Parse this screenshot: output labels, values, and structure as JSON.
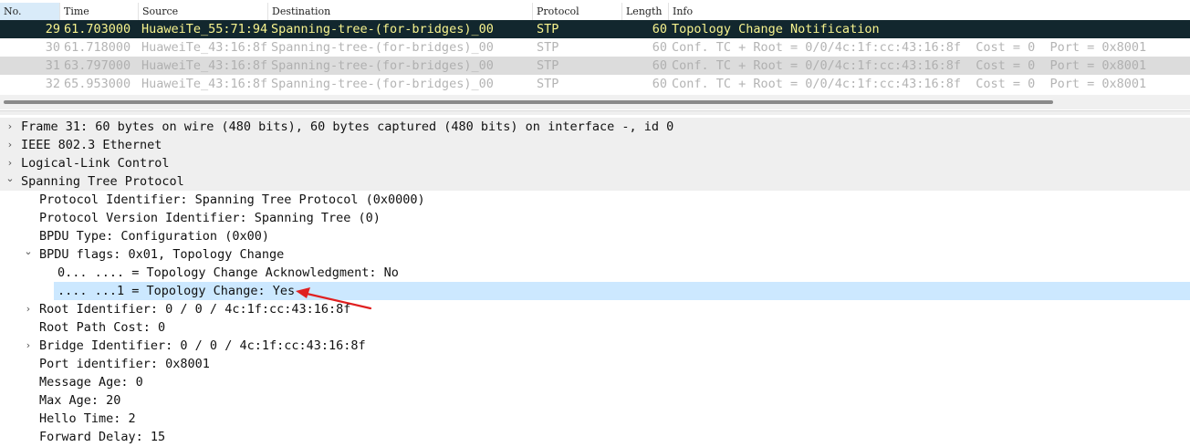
{
  "packet_list": {
    "columns": [
      "No.",
      "Time",
      "Source",
      "Destination",
      "Protocol",
      "Length",
      "Info"
    ],
    "rows": [
      {
        "no": "29",
        "time": "61.703000",
        "src": "HuaweiTe_55:71:94",
        "dst": "Spanning-tree-(for-bridges)_00",
        "proto": "STP",
        "len": "60",
        "info": "Topology Change Notification"
      },
      {
        "no": "30",
        "time": "61.718000",
        "src": "HuaweiTe_43:16:8f",
        "dst": "Spanning-tree-(for-bridges)_00",
        "proto": "STP",
        "len": "60",
        "info": "Conf. TC + Root = 0/0/4c:1f:cc:43:16:8f  Cost = 0  Port = 0x8001"
      },
      {
        "no": "31",
        "time": "63.797000",
        "src": "HuaweiTe_43:16:8f",
        "dst": "Spanning-tree-(for-bridges)_00",
        "proto": "STP",
        "len": "60",
        "info": "Conf. TC + Root = 0/0/4c:1f:cc:43:16:8f  Cost = 0  Port = 0x8001"
      },
      {
        "no": "32",
        "time": "65.953000",
        "src": "HuaweiTe_43:16:8f",
        "dst": "Spanning-tree-(for-bridges)_00",
        "proto": "STP",
        "len": "60",
        "info": "Conf. TC + Root = 0/0/4c:1f:cc:43:16:8f  Cost = 0  Port = 0x8001"
      }
    ]
  },
  "detail_tree": [
    {
      "text": "Frame 31: 60 bytes on wire (480 bits), 60 bytes captured (480 bits) on interface -, id 0",
      "chevron": "right"
    },
    {
      "text": "IEEE 802.3 Ethernet",
      "chevron": "right"
    },
    {
      "text": "Logical-Link Control",
      "chevron": "right"
    },
    {
      "text": "Spanning Tree Protocol",
      "chevron": "down"
    },
    {
      "text": "Protocol Identifier: Spanning Tree Protocol (0x0000)",
      "chevron": ""
    },
    {
      "text": "Protocol Version Identifier: Spanning Tree (0)",
      "chevron": ""
    },
    {
      "text": "BPDU Type: Configuration (0x00)",
      "chevron": ""
    },
    {
      "text": "BPDU flags: 0x01, Topology Change",
      "chevron": "down"
    },
    {
      "text": "0... .... = Topology Change Acknowledgment: No",
      "chevron": ""
    },
    {
      "text": ".... ...1 = Topology Change: Yes",
      "chevron": ""
    },
    {
      "text": "Root Identifier: 0 / 0 / 4c:1f:cc:43:16:8f",
      "chevron": "right"
    },
    {
      "text": "Root Path Cost: 0",
      "chevron": ""
    },
    {
      "text": "Bridge Identifier: 0 / 0 / 4c:1f:cc:43:16:8f",
      "chevron": "right"
    },
    {
      "text": "Port identifier: 0x8001",
      "chevron": ""
    },
    {
      "text": "Message Age: 0",
      "chevron": ""
    },
    {
      "text": "Max Age: 20",
      "chevron": ""
    },
    {
      "text": "Hello Time: 2",
      "chevron": ""
    },
    {
      "text": "Forward Delay: 15",
      "chevron": ""
    }
  ],
  "icons": {
    "chevron_right": "›",
    "chevron_down": "⌄"
  },
  "colors": {
    "selected_row_bg": "#12272e",
    "selected_row_fg": "#f7f38e",
    "highlight_row_bg": "#cce8ff",
    "annotation_arrow": "#e02020"
  }
}
